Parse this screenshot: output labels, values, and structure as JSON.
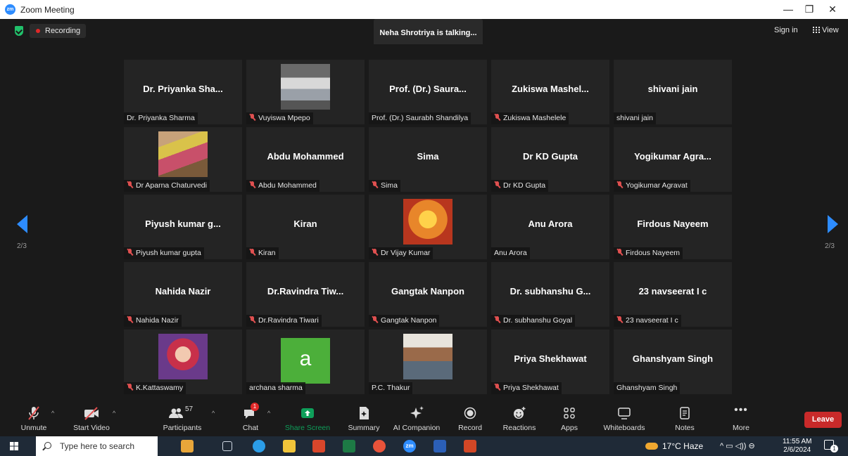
{
  "window": {
    "title": "Zoom Meeting",
    "app_icon_text": "zm"
  },
  "meeting_bar": {
    "recording_label": "Recording",
    "talking_banner": "Neha Shrotriya is talking...",
    "sign_in": "Sign in",
    "view": "View"
  },
  "pager": {
    "left_page": "2/3",
    "right_page": "2/3"
  },
  "participants": [
    {
      "big": "Dr. Priyanka Sha...",
      "label": "Dr. Priyanka Sharma",
      "muted": false,
      "photo": ""
    },
    {
      "big": "",
      "label": "Vuyiswa Mpepo",
      "muted": true,
      "photo": "car"
    },
    {
      "big": "Prof. (Dr.) Saura...",
      "label": "Prof. (Dr.) Saurabh Shandilya",
      "muted": false,
      "photo": ""
    },
    {
      "big": "Zukiswa Mashel...",
      "label": "Zukiswa Mashelele",
      "muted": true,
      "photo": ""
    },
    {
      "big": "shivani jain",
      "label": "shivani jain",
      "muted": false,
      "photo": ""
    },
    {
      "big": "",
      "label": "Dr Aparna Chaturvedi",
      "muted": true,
      "photo": "woman"
    },
    {
      "big": "Abdu Mohammed",
      "label": "Abdu Mohammed",
      "muted": true,
      "photo": ""
    },
    {
      "big": "Sima",
      "label": "Sima",
      "muted": true,
      "photo": ""
    },
    {
      "big": "Dr KD Gupta",
      "label": "Dr KD Gupta",
      "muted": true,
      "photo": ""
    },
    {
      "big": "Yogikumar Agra...",
      "label": "Yogikumar Agravat",
      "muted": true,
      "photo": ""
    },
    {
      "big": "Piyush kumar g...",
      "label": "Piyush kumar gupta",
      "muted": true,
      "photo": ""
    },
    {
      "big": "Kiran",
      "label": "Kiran",
      "muted": true,
      "photo": ""
    },
    {
      "big": "",
      "label": "Dr Vijay Kumar",
      "muted": true,
      "photo": "deity"
    },
    {
      "big": "Anu Arora",
      "label": "Anu Arora",
      "muted": false,
      "photo": ""
    },
    {
      "big": "Firdous Nayeem",
      "label": "Firdous Nayeem",
      "muted": true,
      "photo": ""
    },
    {
      "big": "Nahida Nazir",
      "label": "Nahida Nazir",
      "muted": true,
      "photo": ""
    },
    {
      "big": "Dr.Ravindra Tiw...",
      "label": "Dr.Ravindra Tiwari",
      "muted": true,
      "photo": ""
    },
    {
      "big": "Gangtak Nanpon",
      "label": "Gangtak Nanpon",
      "muted": true,
      "photo": ""
    },
    {
      "big": "Dr. subhanshu G...",
      "label": "Dr. subhanshu Goyal",
      "muted": true,
      "photo": ""
    },
    {
      "big": "23 navseerat I c",
      "label": "23 navseerat I c",
      "muted": true,
      "photo": ""
    },
    {
      "big": "",
      "label": "K.Kattaswamy",
      "muted": true,
      "photo": "baby"
    },
    {
      "big": "",
      "label": "archana sharma",
      "muted": false,
      "photo": "avatar-a"
    },
    {
      "big": "",
      "label": "P.C. Thakur",
      "muted": false,
      "photo": "man"
    },
    {
      "big": "Priya Shekhawat",
      "label": "Priya Shekhawat",
      "muted": true,
      "photo": ""
    },
    {
      "big": "Ghanshyam Singh",
      "label": "Ghanshyam Singh",
      "muted": false,
      "photo": ""
    }
  ],
  "avatar_letter": "a",
  "toolbar": {
    "unmute": "Unmute",
    "start_video": "Start Video",
    "participants": "Participants",
    "participants_count": "57",
    "chat": "Chat",
    "chat_badge": "1",
    "share_screen": "Share Screen",
    "summary": "Summary",
    "ai_companion": "AI Companion",
    "record": "Record",
    "reactions": "Reactions",
    "apps": "Apps",
    "whiteboards": "Whiteboards",
    "notes": "Notes",
    "more": "More",
    "leave": "Leave"
  },
  "taskbar": {
    "search_placeholder": "Type here to search",
    "weather": "17°C  Haze",
    "time": "11:55 AM",
    "date": "2/6/2024",
    "notification_count": "1"
  },
  "colors": {
    "accent": "#2d8cff",
    "share_green": "#0e9f5a",
    "leave_red": "#c92a2a",
    "mute_red": "#e05050"
  }
}
